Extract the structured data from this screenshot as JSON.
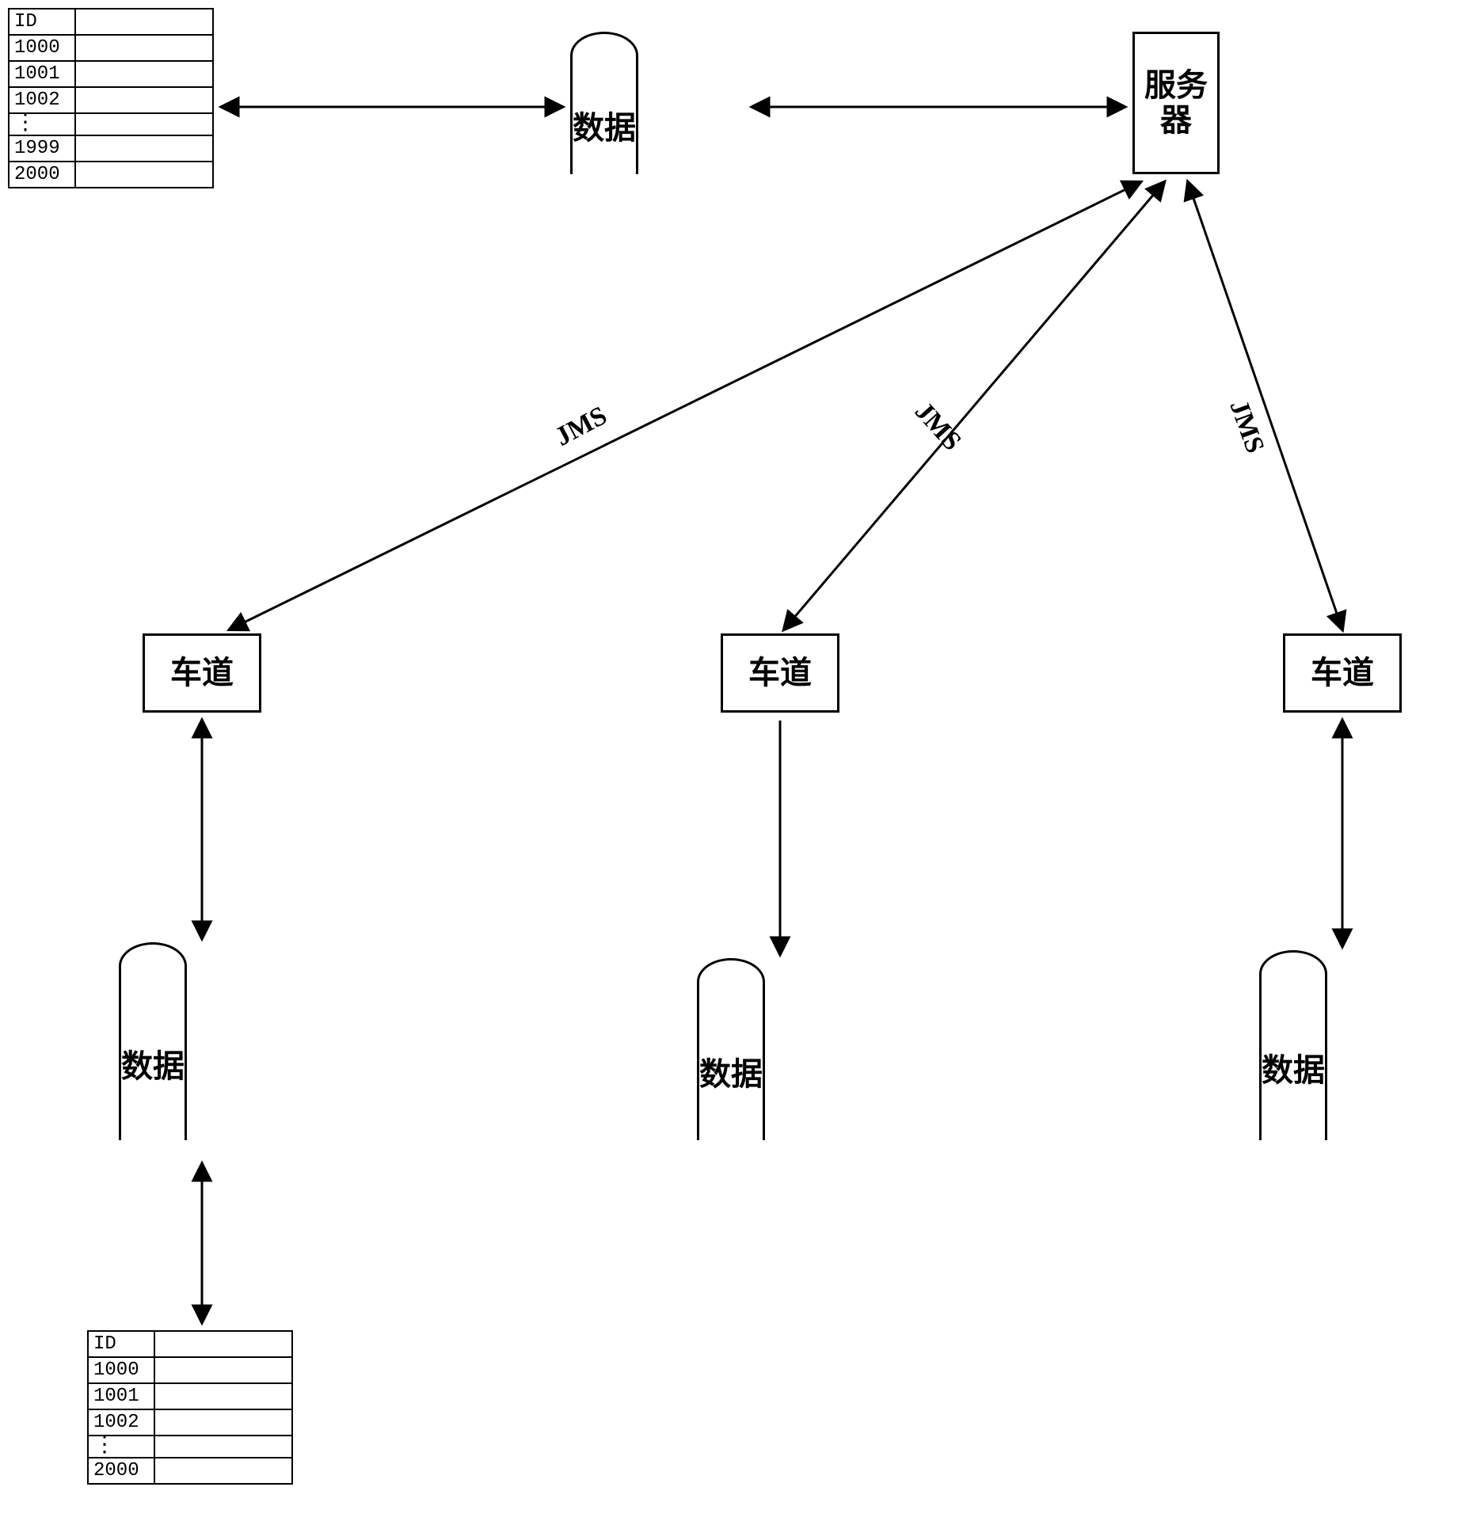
{
  "tables": {
    "top": {
      "header": "ID",
      "rows": [
        "1000",
        "1001",
        "1002"
      ],
      "tail": [
        "1999",
        "2000"
      ]
    },
    "bottom": {
      "header": "ID",
      "rows": [
        "1000",
        "1001",
        "1002"
      ],
      "tail": [
        "2000"
      ]
    }
  },
  "nodes": {
    "db_main": "数据",
    "server": "服务\n器",
    "lane": "车道",
    "db_lane": "数据"
  },
  "labels": {
    "jms": "JMS"
  }
}
